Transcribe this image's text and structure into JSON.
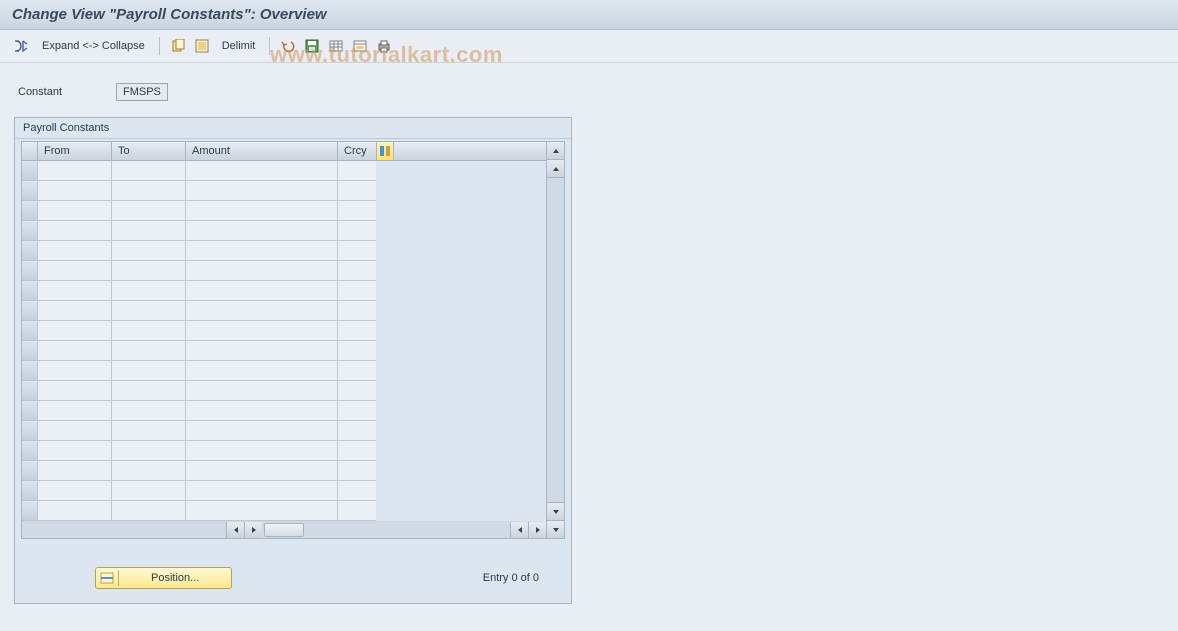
{
  "title": "Change View \"Payroll Constants\": Overview",
  "toolbar": {
    "expand_collapse": "Expand <-> Collapse",
    "delimit": "Delimit"
  },
  "field": {
    "label": "Constant",
    "value": "FMSPS"
  },
  "panel": {
    "title": "Payroll Constants",
    "columns": {
      "from": "From",
      "to": "To",
      "amount": "Amount",
      "crcy": "Crcy"
    },
    "rows": [
      "",
      "",
      "",
      "",
      "",
      "",
      "",
      "",
      "",
      "",
      "",
      "",
      "",
      "",
      "",
      "",
      "",
      ""
    ]
  },
  "footer": {
    "position": "Position...",
    "entry": "Entry 0 of 0"
  },
  "watermark": "www.tutorialkart.com"
}
